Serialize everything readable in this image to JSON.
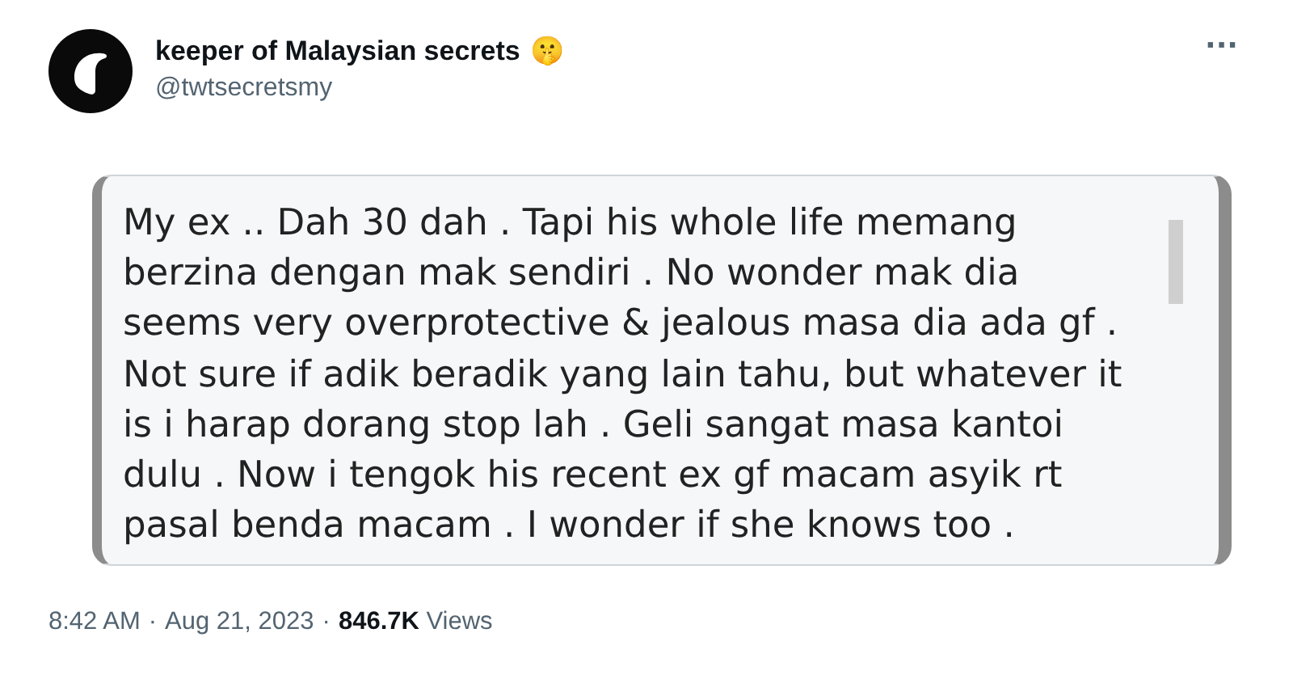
{
  "author": {
    "name": "keeper of Malaysian secrets",
    "emoji": "🤫",
    "handle": "@twtsecretsmy"
  },
  "more": "···",
  "attachment": {
    "kind": "text_screenshot",
    "text": "My ex .. Dah 30 dah . Tapi his whole life memang\nberzina dengan mak sendiri . No wonder mak dia\nseems very overprotective & jealous masa dia ada gf .\nNot sure if adik beradik yang lain tahu, but whatever it\nis i harap dorang stop lah . Geli sangat masa kantoi\ndulu . Now i tengok his recent ex gf macam asyik rt\npasal benda macam . I wonder if she knows too ."
  },
  "meta": {
    "time": "8:42 AM",
    "separators": [
      "·",
      "·"
    ],
    "date": "Aug 21, 2023",
    "views_count": "846.7K",
    "views_label": "Views"
  }
}
